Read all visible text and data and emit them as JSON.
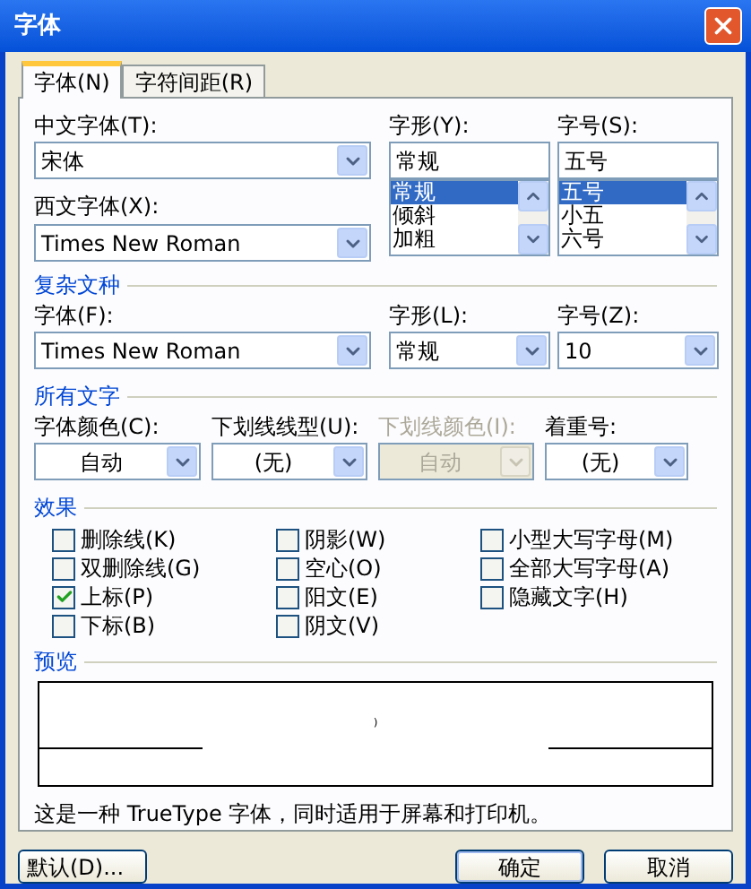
{
  "window": {
    "title": "字体"
  },
  "tabs": [
    {
      "label": "字体(N)",
      "selected": true
    },
    {
      "label": "字符间距(R)",
      "selected": false
    }
  ],
  "main_fonts": {
    "chinese_font": {
      "label": "中文字体(T):",
      "value": "宋体"
    },
    "western_font": {
      "label": "西文字体(X):",
      "value": "Times New Roman"
    },
    "style": {
      "label": "字形(Y):",
      "value": "常规",
      "options": [
        {
          "label": "常规",
          "selected": true
        },
        {
          "label": "倾斜",
          "selected": false
        },
        {
          "label": "加粗",
          "selected": false
        }
      ]
    },
    "size": {
      "label": "字号(S):",
      "value": "五号",
      "options": [
        {
          "label": "五号",
          "selected": true
        },
        {
          "label": "小五",
          "selected": false
        },
        {
          "label": "六号",
          "selected": false
        }
      ]
    }
  },
  "complex_script": {
    "heading": "复杂文种",
    "fields": [
      {
        "label": "字体(F):",
        "value": "Times New Roman"
      },
      {
        "label": "字形(L):",
        "value": "常规"
      },
      {
        "label": "字号(Z):",
        "value": "10"
      }
    ]
  },
  "all_text": {
    "heading": "所有文字",
    "fields": [
      {
        "label": "字体颜色(C):",
        "value": "自动",
        "disabled": false
      },
      {
        "label": "下划线线型(U):",
        "value": "(无)",
        "disabled": false
      },
      {
        "label": "下划线颜色(I):",
        "value": "自动",
        "disabled": true
      },
      {
        "label": "着重号:",
        "value": "(无)",
        "disabled": false
      }
    ]
  },
  "effects": {
    "heading": "效果",
    "columns": [
      [
        {
          "label": "删除线(K)",
          "checked": false
        },
        {
          "label": "双删除线(G)",
          "checked": false
        },
        {
          "label": "上标(P)",
          "checked": true
        },
        {
          "label": "下标(B)",
          "checked": false
        }
      ],
      [
        {
          "label": "阴影(W)",
          "checked": false
        },
        {
          "label": "空心(O)",
          "checked": false
        },
        {
          "label": "阳文(E)",
          "checked": false
        },
        {
          "label": "阴文(V)",
          "checked": false
        }
      ],
      [
        {
          "label": "小型大写字母(M)",
          "checked": false
        },
        {
          "label": "全部大写字母(A)",
          "checked": false
        },
        {
          "label": "隐藏文字(H)",
          "checked": false
        }
      ]
    ]
  },
  "preview": {
    "heading": "预览",
    "text": ")"
  },
  "description": "这是一种 TrueType 字体，同时适用于屏幕和打印机。",
  "buttons": [
    {
      "label": "默认(D)...",
      "kind": "default"
    },
    {
      "label": "确定",
      "kind": "ok"
    },
    {
      "label": "取消",
      "kind": "cancel"
    }
  ]
}
